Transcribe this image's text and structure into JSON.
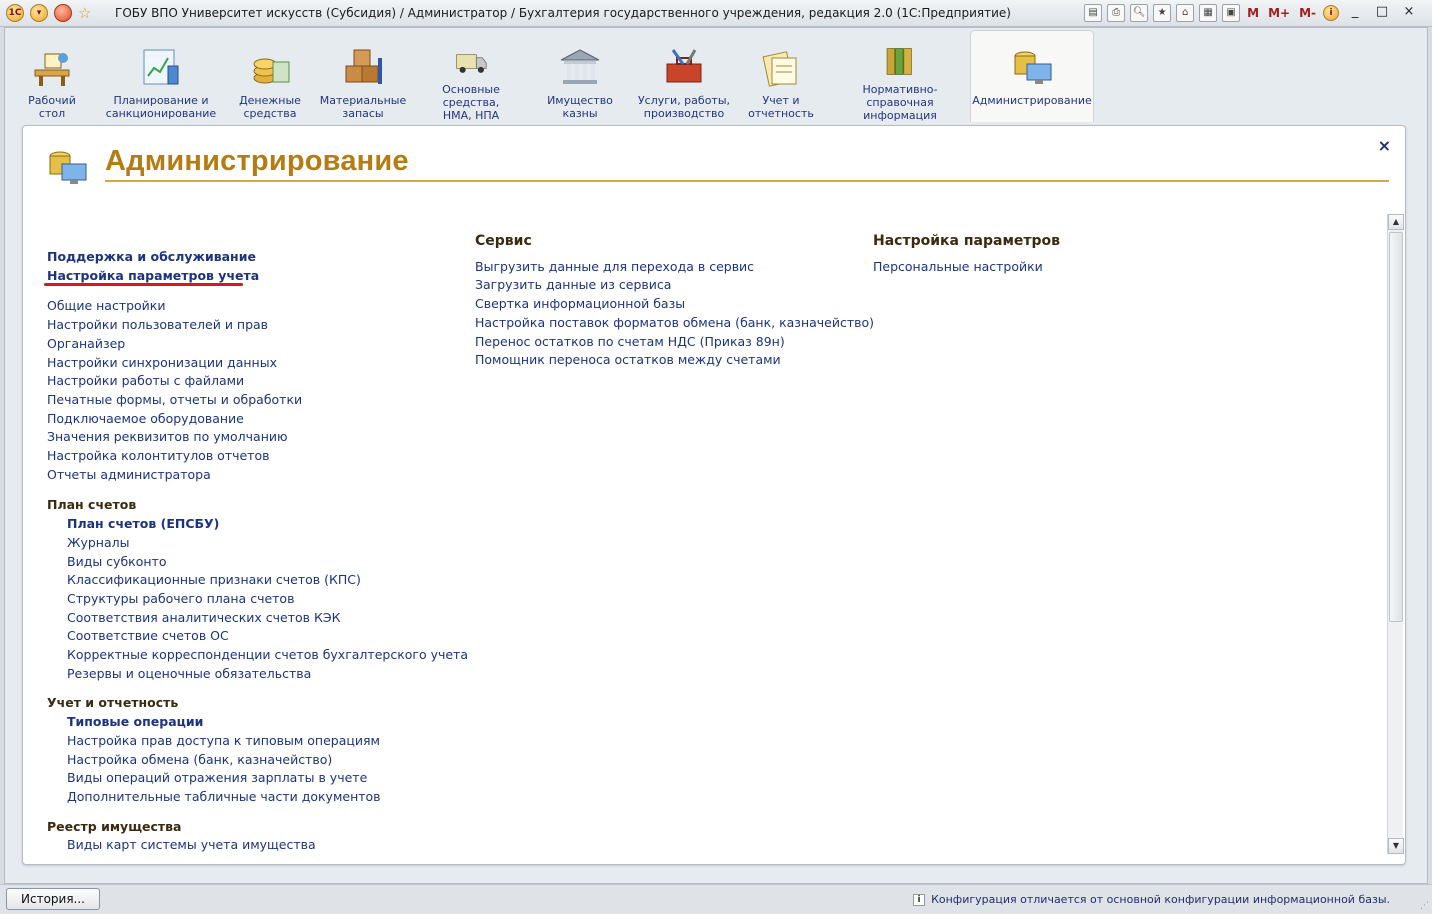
{
  "window": {
    "title": "ГОБУ ВПО Университет искусств (Субсидия) / Администратор / Бухгалтерия государственного учреждения, редакция 2.0  (1С:Предприятие)",
    "app_logo": "1С",
    "mem_buttons": [
      "M",
      "M+",
      "M-"
    ],
    "controls": [
      "_",
      "□",
      "×"
    ]
  },
  "sections": [
    {
      "label": "Рабочий\nстол",
      "icon": "desk-icon"
    },
    {
      "label": "Планирование и\nсанкционирование",
      "icon": "planning-icon"
    },
    {
      "label": "Денежные\nсредства",
      "icon": "coins-icon"
    },
    {
      "label": "Материальные\nзапасы",
      "icon": "boxes-icon"
    },
    {
      "label": "Основные средства,\nНМА, НПА",
      "icon": "truck-icon"
    },
    {
      "label": "Имущество\nказны",
      "icon": "building-icon"
    },
    {
      "label": "Услуги, работы,\nпроизводство",
      "icon": "toolbox-icon"
    },
    {
      "label": "Учет и\nотчетность",
      "icon": "report-icon"
    },
    {
      "label": "Нормативно-справочная\nинформация",
      "icon": "folders-icon"
    },
    {
      "label": "Администрирование",
      "icon": "admin-icon",
      "active": true
    }
  ],
  "page": {
    "title": "Администрирование",
    "close": "×"
  },
  "col1": {
    "top_links": [
      "Поддержка и обслуживание",
      "Настройка параметров учета"
    ],
    "links": [
      "Общие настройки",
      "Настройки пользователей и прав",
      "Органайзер",
      "Настройки синхронизации данных",
      "Настройки работы с файлами",
      "Печатные формы, отчеты и обработки",
      "Подключаемое оборудование",
      "Значения реквизитов по умолчанию",
      "Настройка колонтитулов отчетов",
      "Отчеты администратора"
    ],
    "chart_of_accounts": {
      "heading": "План счетов",
      "main": "План счетов (ЕПСБУ)",
      "items": [
        "Журналы",
        "Виды субконто",
        "Классификационные признаки счетов (КПС)",
        "Структуры рабочего плана счетов",
        "Соответствия аналитических счетов КЭК",
        "Соответствие счетов ОС",
        "Корректные корреспонденции счетов бухгалтерского учета",
        "Резервы и оценочные обязательства"
      ]
    },
    "accounting": {
      "heading": "Учет и отчетность",
      "main": "Типовые операции",
      "items": [
        "Настройка прав доступа к типовым операциям",
        "Настройка обмена (банк, казначейство)",
        "Виды операций отражения зарплаты в учете",
        "Дополнительные табличные части документов"
      ]
    },
    "registry": {
      "heading": "Реестр имущества",
      "items": [
        "Виды карт системы учета имущества"
      ]
    }
  },
  "col2": {
    "heading": "Сервис",
    "links": [
      "Выгрузить данные для перехода в сервис",
      "Загрузить данные из сервиса",
      "Свертка информационной базы",
      "Настройка поставок форматов обмена (банк, казначейство)",
      "Перенос остатков по счетам НДС (Приказ 89н)",
      "Помощник переноса остатков между счетами"
    ]
  },
  "col3": {
    "heading": "Настройка параметров",
    "links": [
      "Персональные настройки"
    ]
  },
  "statusbar": {
    "history_button": "История...",
    "message": "Конфигурация отличается от основной конфигурации информационной базы."
  }
}
